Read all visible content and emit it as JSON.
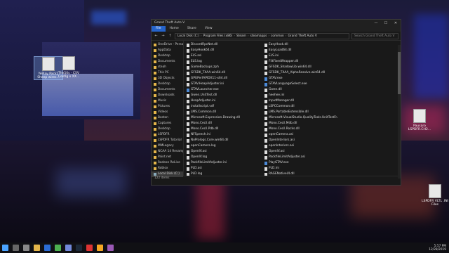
{
  "window": {
    "title": "Grand Theft Auto V",
    "min": "—",
    "max": "☐",
    "close": "✕"
  },
  "ribbon": {
    "tabs": [
      "File",
      "Home",
      "Share",
      "View"
    ]
  },
  "address": {
    "back": "←",
    "forward": "→",
    "up": "↑",
    "path": [
      "Local Disk (C:)",
      "Program Files (x86)",
      "Steam",
      "steamapps",
      "common",
      "Grand Theft Auto V"
    ],
    "search_placeholder": "Search Grand Theft Auto V"
  },
  "nav": {
    "items": [
      {
        "label": "OneDrive - Person",
        "kind": "cloud"
      },
      {
        "label": "AppData",
        "kind": "folder"
      },
      {
        "label": "Desktop",
        "kind": "folder"
      },
      {
        "label": "Documents",
        "kind": "folder"
      },
      {
        "label": "steah",
        "kind": "folder"
      },
      {
        "label": "This PC",
        "kind": "pc"
      },
      {
        "label": "3D Objects",
        "kind": "folder"
      },
      {
        "label": "Desktop",
        "kind": "folder"
      },
      {
        "label": "Documents",
        "kind": "folder"
      },
      {
        "label": "Downloads",
        "kind": "folder"
      },
      {
        "label": "Music",
        "kind": "folder"
      },
      {
        "label": "Pictures",
        "kind": "folder"
      },
      {
        "label": "Videos",
        "kind": "folder"
      },
      {
        "label": "Boston",
        "kind": "folder"
      },
      {
        "label": "Captures",
        "kind": "folder"
      },
      {
        "label": "Desktop",
        "kind": "folder"
      },
      {
        "label": "LSPDFR",
        "kind": "folder"
      },
      {
        "label": "LSPDFR Tutorial",
        "kind": "folder"
      },
      {
        "label": "MMLegacy",
        "kind": "folder"
      },
      {
        "label": "NCAA 14 Revamp",
        "kind": "folder"
      },
      {
        "label": "Paint.net",
        "kind": "folder"
      },
      {
        "label": "Radeon ReLive",
        "kind": "folder"
      },
      {
        "label": "Roblox",
        "kind": "folder"
      },
      {
        "label": "Local Disk (C:)",
        "kind": "drive"
      }
    ]
  },
  "files": {
    "col1": [
      {
        "name": "DiscordRpcNet.dll",
        "kind": "file"
      },
      {
        "name": "EasyHook64.dll",
        "kind": "file"
      },
      {
        "name": "ELS.asi",
        "kind": "file"
      },
      {
        "name": "ELS.log",
        "kind": "file"
      },
      {
        "name": "GameBackups.zph",
        "kind": "file"
      },
      {
        "name": "GFSDK_TXAA.win64.dll",
        "kind": "file"
      },
      {
        "name": "GPUPerfAPIDX11-x64.dll",
        "kind": "file"
      },
      {
        "name": "GTAV.HeapAdjuster.ini",
        "kind": "file"
      },
      {
        "name": "GTAVLauncher.exe",
        "kind": "exe"
      },
      {
        "name": "Gwen.UnitTest.dll",
        "kind": "file"
      },
      {
        "name": "HeapAdjuster.ini",
        "kind": "file"
      },
      {
        "name": "installscript.vdf",
        "kind": "file"
      },
      {
        "name": "LMS.Common.dll",
        "kind": "file"
      },
      {
        "name": "Microsoft.Expression.Drawing.dll",
        "kind": "file"
      },
      {
        "name": "Mono.Cecil.dll",
        "kind": "file"
      },
      {
        "name": "Mono.Cecil.Pdb.dll",
        "kind": "file"
      },
      {
        "name": "NFSpeech.ini",
        "kind": "file"
      },
      {
        "name": "NoPrologs.Core.win64.dll",
        "kind": "file"
      },
      {
        "name": "openCamera.log",
        "kind": "file"
      },
      {
        "name": "OpenIV.asi",
        "kind": "file"
      },
      {
        "name": "OpenIV.log",
        "kind": "file"
      },
      {
        "name": "PackfileLimitAdjuster.ini",
        "kind": "file"
      },
      {
        "name": "PLD.asi",
        "kind": "file"
      },
      {
        "name": "PLD.log",
        "kind": "file"
      },
      {
        "name": "RAGENativeUI.xml",
        "kind": "file"
      },
      {
        "name": "RagePluginHook.ini",
        "kind": "file"
      },
      {
        "name": "ScriptHookV.dll",
        "kind": "file"
      },
      {
        "name": "ScriptHookVDotNet.asi",
        "kind": "file"
      }
    ],
    "col2": [
      {
        "name": "EasyHook.dll",
        "kind": "file"
      },
      {
        "name": "EasyLoad64.dll",
        "kind": "file"
      },
      {
        "name": "ELS.ini",
        "kind": "file"
      },
      {
        "name": "FlitFixedWrapper.dll",
        "kind": "file"
      },
      {
        "name": "GFSDK_ShadowLib.win64.dll",
        "kind": "file"
      },
      {
        "name": "GFSDK_TXAA_AlphaResolve.win64.dll",
        "kind": "file"
      },
      {
        "name": "GTAV.exe",
        "kind": "exe"
      },
      {
        "name": "GTAVLanguageSelect.exe",
        "kind": "exe"
      },
      {
        "name": "Gwen.dll",
        "kind": "file"
      },
      {
        "name": "heehee.ini",
        "kind": "file"
      },
      {
        "name": "InputManager.dll",
        "kind": "file"
      },
      {
        "name": "LSPCCommon.dll",
        "kind": "file"
      },
      {
        "name": "LMS.PortableExtensible.dll",
        "kind": "file"
      },
      {
        "name": "Microsoft.VisualStudio.QualityTools.UnitTestFr...",
        "kind": "file"
      },
      {
        "name": "Mono.Cecil.Mdb.dll",
        "kind": "file"
      },
      {
        "name": "Mono.Cecil.Rocks.dll",
        "kind": "file"
      },
      {
        "name": "openCamera.asi",
        "kind": "file"
      },
      {
        "name": "OpenInteriors.asi",
        "kind": "file"
      },
      {
        "name": "openInteriors.asi",
        "kind": "file"
      },
      {
        "name": "OpenIV.asi",
        "kind": "file"
      },
      {
        "name": "PackfileLimitAdjuster.asi",
        "kind": "file"
      },
      {
        "name": "PlayGTAV.exe",
        "kind": "exe"
      },
      {
        "name": "PLD.ini",
        "kind": "file"
      },
      {
        "name": "RAGENativeUI.dll",
        "kind": "file"
      },
      {
        "name": "RAGEPluginHook.exe",
        "kind": "exe"
      },
      {
        "name": "RagePluginHook.log",
        "kind": "file"
      },
      {
        "name": "ScriptHookV.log",
        "kind": "file"
      },
      {
        "name": "ScriptHookVDotNet.log",
        "kind": "file"
      }
    ]
  },
  "status": {
    "items": "122 items"
  },
  "desktop": {
    "icons_left": [
      "YePlay Pack2 Sheep wires...",
      "The50s - CSV Config x XX..."
    ],
    "icons_right": [
      "Pausaro LSPDFR.CH2...",
      "LSPDFR VLTL .INI Files"
    ]
  },
  "clock": {
    "time": "5:57 PM",
    "date": "12/28/2019"
  },
  "colors": {
    "accent": "#2563c9",
    "window_bg": "#191919",
    "folder": "#e4b54a"
  }
}
